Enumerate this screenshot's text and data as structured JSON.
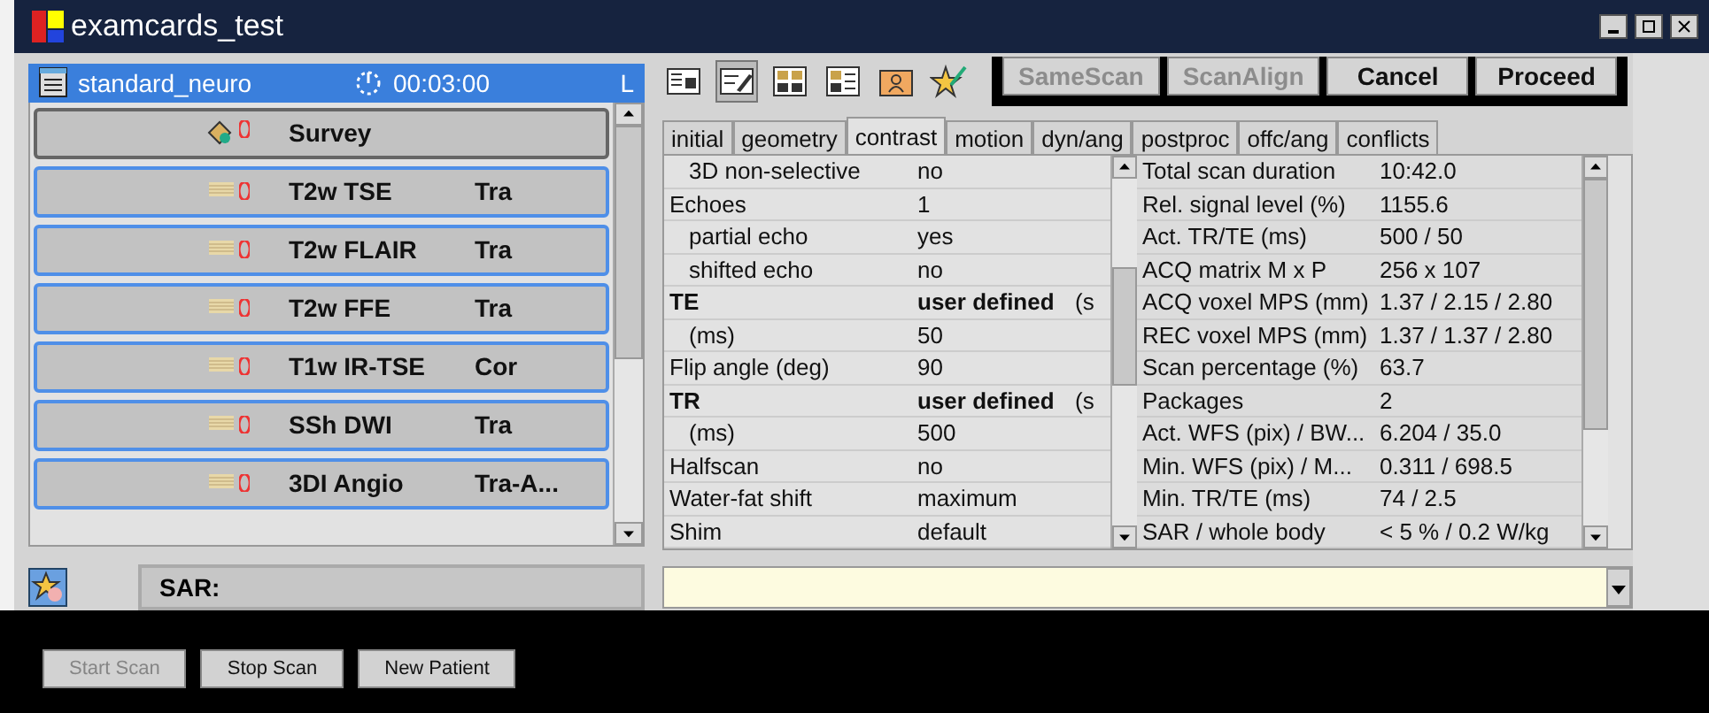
{
  "window": {
    "title": "examcards_test"
  },
  "examcard": {
    "name": "standard_neuro",
    "duration": "00:03:00",
    "side": "L"
  },
  "scans": [
    {
      "name": "Survey",
      "kind": "survey"
    },
    {
      "name": "T2w TSE",
      "orientation": "Tra",
      "kind": "scan"
    },
    {
      "name": "T2w FLAIR",
      "orientation": "Tra",
      "kind": "scan"
    },
    {
      "name": "T2w FFE",
      "orientation": "Tra",
      "kind": "scan"
    },
    {
      "name": "T1w IR-TSE",
      "orientation": "Cor",
      "kind": "scan"
    },
    {
      "name": "SSh DWI",
      "orientation": "Tra",
      "kind": "scan"
    },
    {
      "name": "3DI Angio",
      "orientation": "Tra-A...",
      "kind": "scan"
    }
  ],
  "sar": {
    "label": "SAR:"
  },
  "toolbar": [
    {
      "selected": false
    },
    {
      "selected": true
    },
    {
      "selected": false
    },
    {
      "selected": false
    },
    {
      "selected": false
    },
    {
      "selected": false
    }
  ],
  "top_buttons": [
    {
      "label": "SameScan",
      "disabled": true
    },
    {
      "label": "ScanAlign",
      "disabled": true
    },
    {
      "label": "Cancel",
      "disabled": false
    },
    {
      "label": "Proceed",
      "disabled": false
    }
  ],
  "tabs": [
    {
      "label": "initial",
      "selected": false
    },
    {
      "label": "geometry",
      "selected": false
    },
    {
      "label": "contrast",
      "selected": true
    },
    {
      "label": "motion",
      "selected": false
    },
    {
      "label": "dyn/ang",
      "selected": false
    },
    {
      "label": "postproc",
      "selected": false
    },
    {
      "label": "offc/ang",
      "selected": false
    },
    {
      "label": "conflicts",
      "selected": false
    }
  ],
  "parameters": [
    {
      "name": "3D non-selective",
      "value": "no",
      "indent": true,
      "bold": false
    },
    {
      "name": "Echoes",
      "value": "1",
      "indent": false,
      "bold": false
    },
    {
      "name": "partial echo",
      "value": "yes",
      "indent": true,
      "bold": false
    },
    {
      "name": "shifted echo",
      "value": "no",
      "indent": true,
      "bold": false
    },
    {
      "name": "TE",
      "value": "user defined",
      "extra": "(s",
      "indent": false,
      "bold": true
    },
    {
      "name": "(ms)",
      "value": "50",
      "indent": true,
      "bold": false
    },
    {
      "name": "Flip angle (deg)",
      "value": "90",
      "indent": false,
      "bold": false
    },
    {
      "name": "TR",
      "value": "user defined",
      "extra": "(s",
      "indent": false,
      "bold": true
    },
    {
      "name": "(ms)",
      "value": "500",
      "indent": true,
      "bold": false
    },
    {
      "name": "Halfscan",
      "value": "no",
      "indent": false,
      "bold": false
    },
    {
      "name": "Water-fat shift",
      "value": "maximum",
      "indent": false,
      "bold": false
    },
    {
      "name": "Shim",
      "value": "default",
      "indent": false,
      "bold": false
    }
  ],
  "info": [
    {
      "name": "Total scan duration",
      "value": "10:42.0"
    },
    {
      "name": "Rel. signal level (%)",
      "value": "1155.6"
    },
    {
      "name": "Act. TR/TE (ms)",
      "value": "500 / 50"
    },
    {
      "name": "ACQ matrix M x P",
      "value": "256 x 107"
    },
    {
      "name": "ACQ voxel MPS (mm)",
      "value": "1.37 / 2.15 / 2.80"
    },
    {
      "name": "REC voxel MPS (mm)",
      "value": "1.37 / 1.37 / 2.80"
    },
    {
      "name": "Scan percentage (%)",
      "value": "63.7"
    },
    {
      "name": "Packages",
      "value": "2"
    },
    {
      "name": "Act. WFS (pix) / BW...",
      "value": "6.204 / 35.0"
    },
    {
      "name": "Min. WFS (pix) / M...",
      "value": "0.311 / 698.5"
    },
    {
      "name": "Min. TR/TE (ms)",
      "value": "74 / 2.5"
    },
    {
      "name": "SAR / whole body",
      "value": "< 5 % / 0.2 W/kg"
    }
  ],
  "bottom_buttons": [
    {
      "label": "Start Scan",
      "disabled": true
    },
    {
      "label": "Stop Scan",
      "disabled": false
    },
    {
      "label": "New Patient",
      "disabled": false
    }
  ]
}
